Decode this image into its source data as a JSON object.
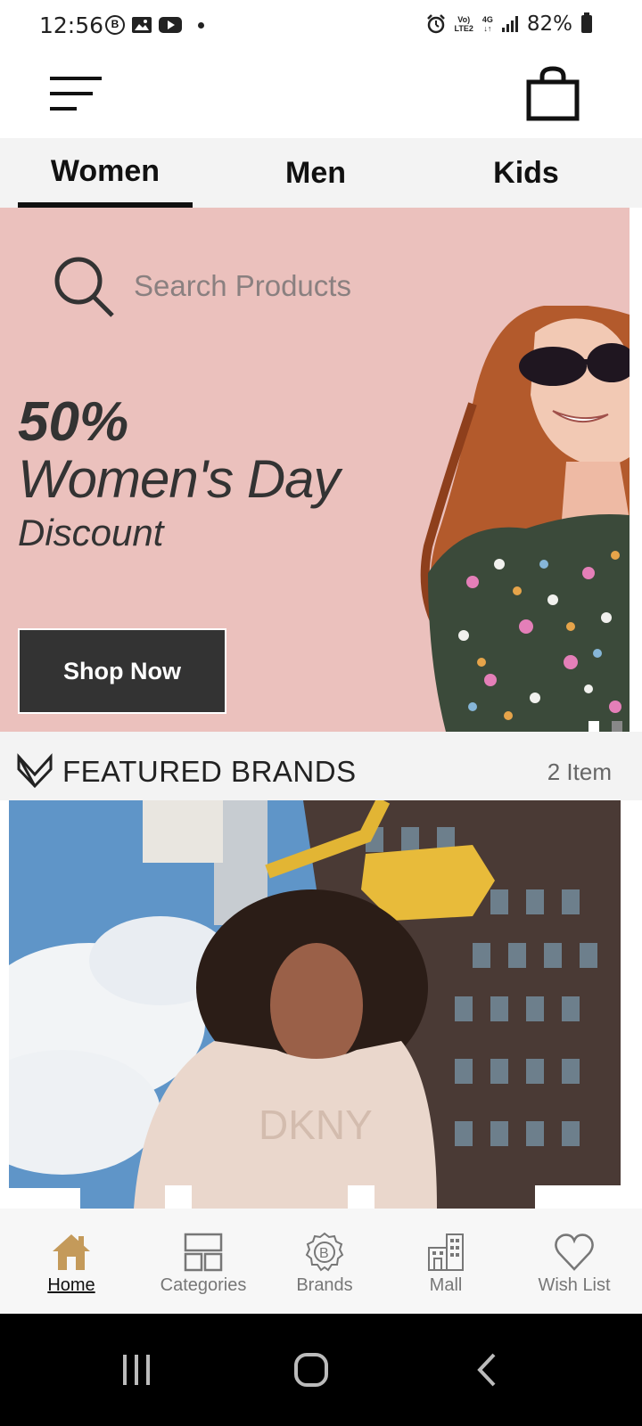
{
  "status_bar": {
    "time": "12:56",
    "lte_top": "Vo)",
    "lte_bottom": "LTE2",
    "network": "4G",
    "battery": "82%"
  },
  "header": {
    "menu_icon": "hamburger-icon",
    "bag_icon": "shopping-bag-icon"
  },
  "tabs": [
    {
      "label": "Women",
      "active": true
    },
    {
      "label": "Men",
      "active": false
    },
    {
      "label": "Kids",
      "active": false
    }
  ],
  "hero": {
    "search_placeholder": "Search Products",
    "promo_percent": "50%",
    "promo_title": "Women's Day",
    "promo_subtitle": "Discount",
    "cta_label": "Shop Now",
    "background_color": "#ebc1bd"
  },
  "featured_brands": {
    "title": "FEATURED BRANDS",
    "count": "2 Item",
    "banner_text": "DKNY"
  },
  "bottom_nav": [
    {
      "label": "Home",
      "icon": "home-icon",
      "active": true
    },
    {
      "label": "Categories",
      "icon": "categories-icon",
      "active": false
    },
    {
      "label": "Brands",
      "icon": "brands-badge-icon",
      "active": false
    },
    {
      "label": "Mall",
      "icon": "mall-building-icon",
      "active": false
    },
    {
      "label": "Wish List",
      "icon": "heart-icon",
      "active": false
    }
  ],
  "colors": {
    "accent": "#c49a5a",
    "dark_button": "#333333",
    "tab_bg": "#f3f3f3"
  }
}
